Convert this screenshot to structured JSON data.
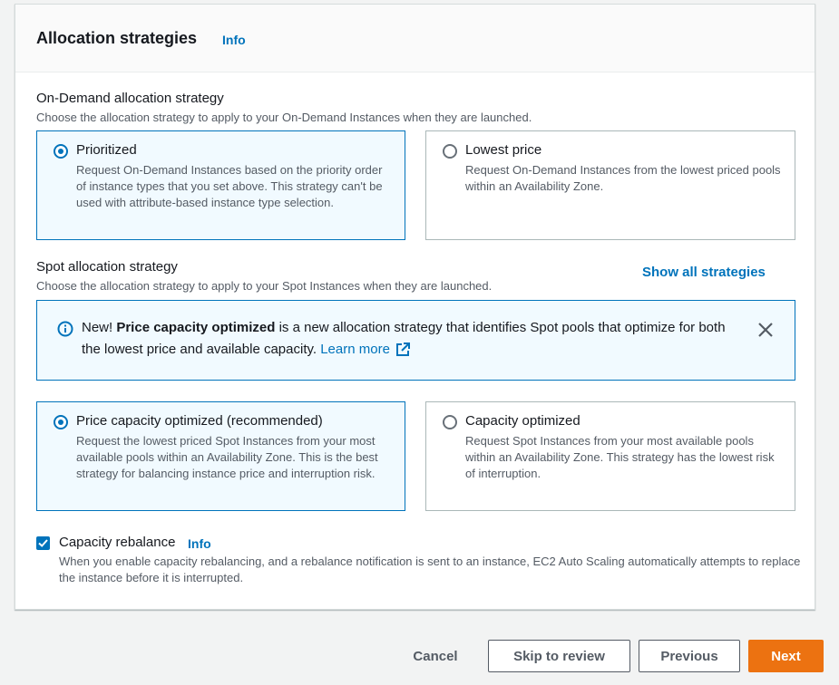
{
  "section": {
    "title": "Allocation strategies",
    "info_label": "Info"
  },
  "on_demand": {
    "label": "On-Demand allocation strategy",
    "description": "Choose the allocation strategy to apply to your On-Demand Instances when they are launched.",
    "options": [
      {
        "title": "Prioritized",
        "description": "Request On-Demand Instances based on the priority order of instance types that you set above. This strategy can't be used with attribute-based instance type selection.",
        "selected": true
      },
      {
        "title": "Lowest price",
        "description": "Request On-Demand Instances from the lowest priced pools within an Availability Zone.",
        "selected": false
      }
    ]
  },
  "spot": {
    "label": "Spot allocation strategy",
    "description": "Choose the allocation strategy to apply to your Spot Instances when they are launched.",
    "show_all_label": "Show all strategies",
    "flash": {
      "prefix": "New! ",
      "bold": "Price capacity optimized",
      "text": " is a new allocation strategy that identifies Spot pools that optimize for both the lowest price and available capacity. ",
      "link": "Learn more",
      "icon": "info-icon"
    },
    "options": [
      {
        "title": "Price capacity optimized (recommended)",
        "description": "Request the lowest priced Spot Instances from your most available pools within an Availability Zone. This is the best strategy for balancing instance price and interruption risk.",
        "selected": true
      },
      {
        "title": "Capacity optimized",
        "description": "Request Spot Instances from your most available pools within an Availability Zone. This strategy has the lowest risk of interruption.",
        "selected": false
      }
    ]
  },
  "capacity_rebalance": {
    "label": "Capacity rebalance",
    "info_label": "Info",
    "checked": true,
    "description": "When you enable capacity rebalancing, and a rebalance notification is sent to an instance, EC2 Auto Scaling automatically attempts to replace the instance before it is interrupted."
  },
  "footer": {
    "cancel": "Cancel",
    "skip": "Skip to review",
    "previous": "Previous",
    "next": "Next"
  },
  "colors": {
    "accent": "#0073bb",
    "primary_button": "#ec7211"
  }
}
